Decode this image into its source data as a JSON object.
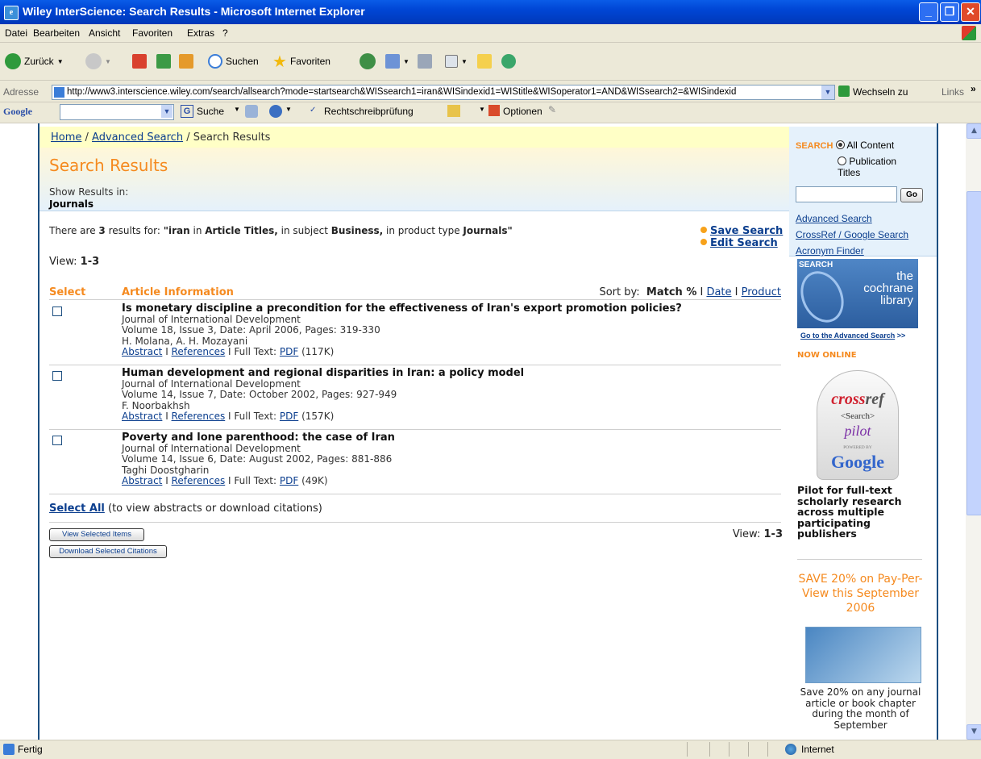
{
  "window": {
    "title": "Wiley InterScience: Search Results - Microsoft Internet Explorer"
  },
  "menu": [
    "Datei",
    "Bearbeiten",
    "Ansicht",
    "Favoriten",
    "Extras",
    "?"
  ],
  "toolbar": {
    "back": "Zurück",
    "search": "Suchen",
    "favorites": "Favoriten"
  },
  "address": {
    "label": "Adresse",
    "url": "http://www3.interscience.wiley.com/search/allsearch?mode=startsearch&WISsearch1=iran&WISindexid1=WIStitle&WISoperator1=AND&WISsearch2=&WISindexid",
    "go": "Wechseln zu",
    "links": "Links"
  },
  "google_bar": {
    "brand": "Google",
    "search": "Suche",
    "spellcheck": "Rechtschreibprüfung",
    "options": "Optionen"
  },
  "breadcrumb": {
    "home": "Home",
    "sep1": " / ",
    "advanced": "Advanced Search",
    "sep2": " / ",
    "current": "Search Results"
  },
  "page_title": "Search Results",
  "show_results_in": "Show Results in:",
  "results_scope": "Journals",
  "results_summary": {
    "pre": "There are ",
    "count": "3",
    "mid": " results for: ",
    "q_open": "\"",
    "q_term": "iran",
    "q_in": " in ",
    "q_field": "Article Titles,",
    "q_subj": " in subject ",
    "q_subject": "Business,",
    "q_prod": " in product type ",
    "q_type": "Journals",
    "q_close": "\""
  },
  "save_search": "Save Search",
  "edit_search": "Edit Search",
  "view_label": "View:",
  "view_range": "1-3",
  "columns": {
    "select": "Select",
    "article_info": "Article Information"
  },
  "sort": {
    "label": "Sort by:",
    "match": "Match %",
    "sep": " I ",
    "date": "Date",
    "product": "Product"
  },
  "results": [
    {
      "title": "Is monetary discipline a precondition for the effectiveness of Iran's export promotion policies?",
      "journal": "Journal of International Development",
      "details": "Volume 18, Issue 3, Date: April 2006, Pages: 319-330",
      "authors": "H. Molana, A. H. Mozayani",
      "abstract": "Abstract",
      "references": "References",
      "fulltext": "Full Text:",
      "pdf": "PDF",
      "size": "(117K)"
    },
    {
      "title": "Human development and regional disparities in Iran: a policy model",
      "journal": "Journal of International Development",
      "details": "Volume 14, Issue 7, Date: October 2002, Pages: 927-949",
      "authors": "F. Noorbakhsh",
      "abstract": "Abstract",
      "references": "References",
      "fulltext": "Full Text:",
      "pdf": "PDF",
      "size": "(157K)"
    },
    {
      "title": "Poverty and lone parenthood: the case of Iran",
      "journal": "Journal of International Development",
      "details": "Volume 14, Issue 6, Date: August 2002, Pages: 881-886",
      "authors": "Taghi Doostgharin",
      "abstract": "Abstract",
      "references": "References",
      "fulltext": "Full Text:",
      "pdf": "PDF",
      "size": "(49K)"
    }
  ],
  "link_sep": " I ",
  "select_all": "Select All",
  "select_all_hint": " (to view abstracts or download citations)",
  "buttons": {
    "view_selected": "View Selected Items",
    "download_citations": "Download Selected Citations"
  },
  "sidebar": {
    "search_label": "SEARCH",
    "all_content": "All Content",
    "publication_titles": "Publication Titles",
    "search_value": "",
    "go": "Go",
    "links": [
      "Advanced Search",
      "CrossRef / Google Search",
      "Acronym Finder"
    ],
    "cochrane_label": "SEARCH",
    "cochrane_the": "the",
    "cochrane_name1": "cochrane",
    "cochrane_name2": "library",
    "cochrane_link": "Go to the Advanced Search",
    "cochrane_arrows": " >>",
    "now_online": "NOW ONLINE",
    "crossref_brand": "cross",
    "crossref_ref": "ref",
    "crossref_search": "<Search>",
    "crossref_pilot": "pilot",
    "crossref_powered": "POWERED BY",
    "crossref_google": "Google",
    "pilot_text": "Pilot for full-text scholarly research across multiple participating publishers",
    "save_promo": "SAVE 20% on Pay-Per-View this September 2006",
    "save_detail": "Save 20% on any journal article or book chapter during the month of September"
  },
  "status": {
    "text": "Fertig",
    "zone": "Internet"
  }
}
